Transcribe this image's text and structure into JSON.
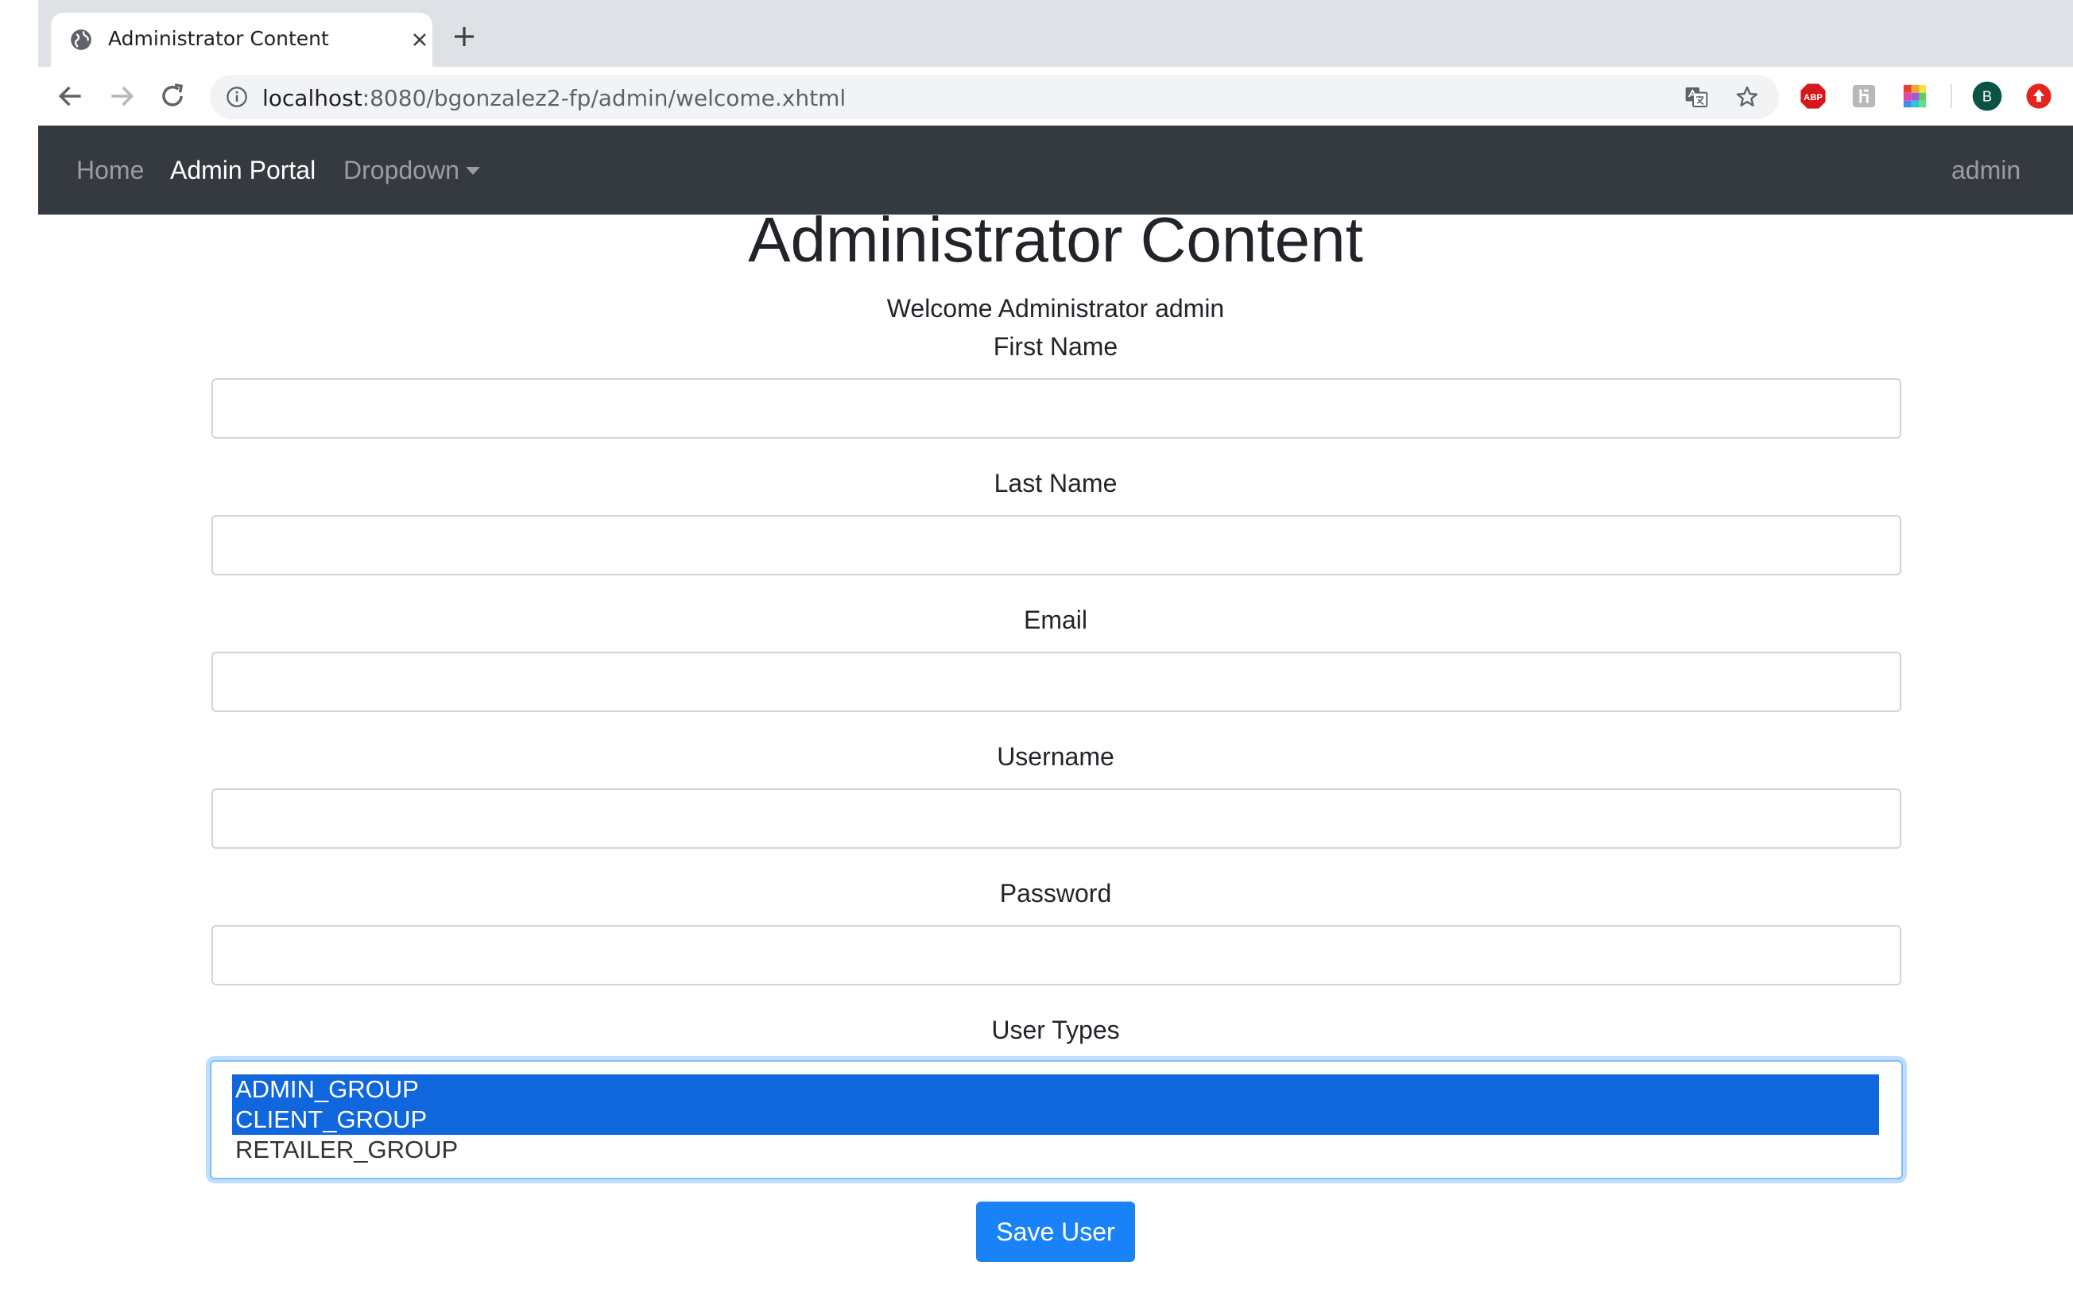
{
  "browser": {
    "tab_title": "Administrator Content",
    "url_host": "localhost",
    "url_rest": ":8080/bgonzalez2-fp/admin/welcome.xhtml",
    "profile_initial": "B",
    "extensions": [
      "translate-icon",
      "abp-icon",
      "extension-icon",
      "color-picker-icon",
      "profile-avatar",
      "upload-icon"
    ],
    "abp_label": "ABP"
  },
  "navbar": {
    "home": "Home",
    "admin_portal": "Admin Portal",
    "dropdown": "Dropdown",
    "user": "admin"
  },
  "page": {
    "title": "Administrator Content",
    "welcome": "Welcome Administrator admin"
  },
  "form": {
    "first_name_label": "First Name",
    "first_name_value": "",
    "last_name_label": "Last Name",
    "last_name_value": "",
    "email_label": "Email",
    "email_value": "",
    "username_label": "Username",
    "username_value": "",
    "password_label": "Password",
    "password_value": "",
    "user_types_label": "User Types",
    "user_types": [
      {
        "label": "ADMIN_GROUP",
        "selected": true
      },
      {
        "label": "CLIENT_GROUP",
        "selected": true
      },
      {
        "label": "RETAILER_GROUP",
        "selected": false
      }
    ],
    "save_label": "Save User"
  },
  "colors": {
    "navbar_bg": "#343a40",
    "primary": "#1a82f7",
    "selection": "#0f66dd"
  }
}
